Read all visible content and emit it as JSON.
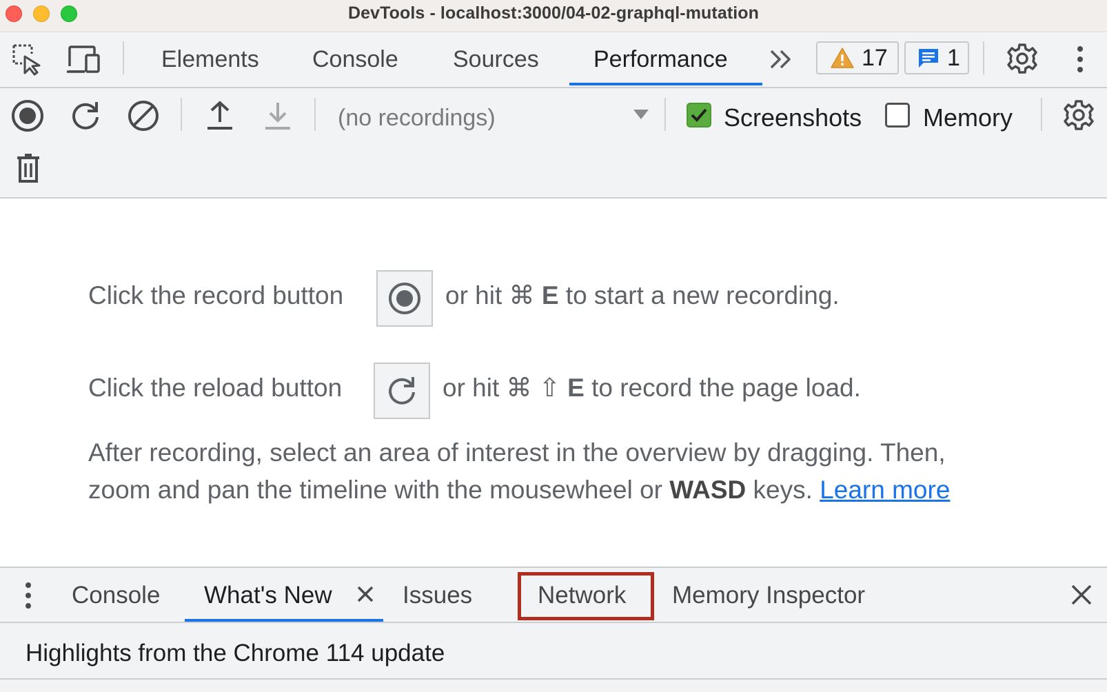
{
  "window": {
    "title": "DevTools - localhost:3000/04-02-graphql-mutation"
  },
  "main_tabs": {
    "items": [
      "Elements",
      "Console",
      "Sources",
      "Performance"
    ],
    "active": "Performance",
    "more_label": "»"
  },
  "badges": {
    "warnings": "17",
    "messages": "1"
  },
  "perf_toolbar": {
    "recordings_select": "(no recordings)",
    "screenshots_label": "Screenshots",
    "screenshots_checked": true,
    "memory_label": "Memory",
    "memory_checked": false
  },
  "landing": {
    "line1_before": "Click the record button",
    "line1_after_prefix": "or hit ⌘",
    "line1_key": "E",
    "line1_after_suffix": "to start a new recording.",
    "line2_before": "Click the reload button",
    "line2_after_prefix": "or hit ⌘ ⇧",
    "line2_key": "E",
    "line2_after_suffix": "to record the page load.",
    "line3": "After recording, select an area of interest in the overview by dragging. Then,",
    "line4_prefix": "zoom and pan the timeline with the mousewheel or",
    "line4_bold": "WASD",
    "line4_suffix": "keys.",
    "learn_more": "Learn more"
  },
  "drawer": {
    "tabs": [
      "Console",
      "What's New",
      "Issues",
      "Network",
      "Memory Inspector"
    ],
    "active": "What's New",
    "highlighted": "Network",
    "content_title": "Highlights from the Chrome 114 update"
  },
  "colors": {
    "accent": "#1a73e8",
    "highlight_box": "#b12d1f",
    "checkbox_checked": "#5aac3e",
    "warning": "#e8a33b"
  }
}
